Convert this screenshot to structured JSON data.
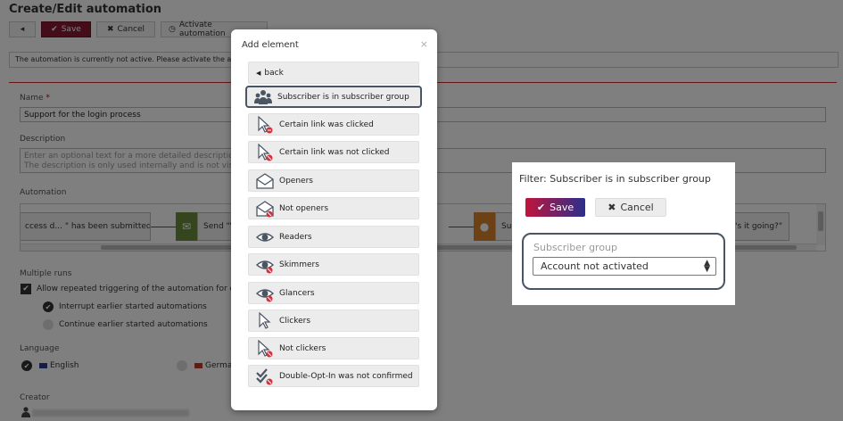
{
  "page": {
    "title": "Create/Edit automation",
    "toolbar": {
      "save": "Save",
      "cancel": "Cancel",
      "activate": "Activate automation"
    },
    "notice": "The automation is currently not active. Please activate the automation",
    "name_label": "Name",
    "name_value": "Support for the login process",
    "description_label": "Description",
    "description_placeholder": "Enter an optional text for a more detailed description\nThe description is only used internally and is not visible",
    "automation_label": "Automation",
    "nodes": {
      "node1": "ccess d... \" has been submitted",
      "node2": "Send \"V",
      "node3": "Su",
      "node4": "'s it going?\""
    },
    "multiple_runs_label": "Multiple runs",
    "allow_repeat": "Allow repeated triggering of the automation for e",
    "interrupt": "Interrupt earlier started automations",
    "continue": "Continue earlier started automations",
    "language_label": "Language",
    "lang_en": "English",
    "lang_de": "Germa",
    "creator_label": "Creator"
  },
  "modal": {
    "title": "Add element",
    "close": "×",
    "items": [
      {
        "label": "back",
        "icon": "back-icon"
      },
      {
        "label": "Subscriber is in subscriber group",
        "icon": "group-icon",
        "active": true
      },
      {
        "label": "Certain link was clicked",
        "icon": "cursor-click-icon"
      },
      {
        "label": "Certain link was not clicked",
        "icon": "cursor-not-click-icon"
      },
      {
        "label": "Openers",
        "icon": "envelope-icon"
      },
      {
        "label": "Not openers",
        "icon": "envelope-not-icon"
      },
      {
        "label": "Readers",
        "icon": "eye-icon"
      },
      {
        "label": "Skimmers",
        "icon": "eye-skim-icon"
      },
      {
        "label": "Glancers",
        "icon": "eye-glance-icon"
      },
      {
        "label": "Clickers",
        "icon": "cursor-icon"
      },
      {
        "label": "Not clickers",
        "icon": "cursor-not-icon"
      },
      {
        "label": "Double-Opt-In was not confirmed",
        "icon": "check-not-icon"
      }
    ]
  },
  "filter": {
    "title": "Filter: Subscriber is in subscriber group",
    "save": "Save",
    "cancel": "Cancel",
    "group_label": "Subscriber group",
    "group_value": "Account not activated"
  },
  "colors": {
    "accent": "#8b1a35",
    "gradient_start": "#c0143c",
    "gradient_end": "#2b2f8c",
    "border_dark": "#4a5563"
  }
}
